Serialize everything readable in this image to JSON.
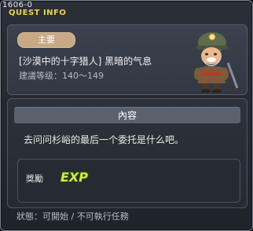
{
  "window": {
    "id": "1606-0",
    "title": "QUEST INFO"
  },
  "quest": {
    "type_badge": "主要",
    "title": "[沙漠中的十字猎人] 黑暗的气息",
    "level": "建議等级：140～149"
  },
  "content": {
    "header": "內容",
    "description": "去问问杉峪的最后一个委托是什么吧。"
  },
  "reward": {
    "label": "獎勵",
    "icon_text": "EXP",
    "icon": "exp-icon"
  },
  "status": {
    "text": "狀態：可開始 / 不可執行任務"
  },
  "colors": {
    "accent": "#f0d24a",
    "badge": "#c7a984",
    "exp": "#cfe84f"
  }
}
